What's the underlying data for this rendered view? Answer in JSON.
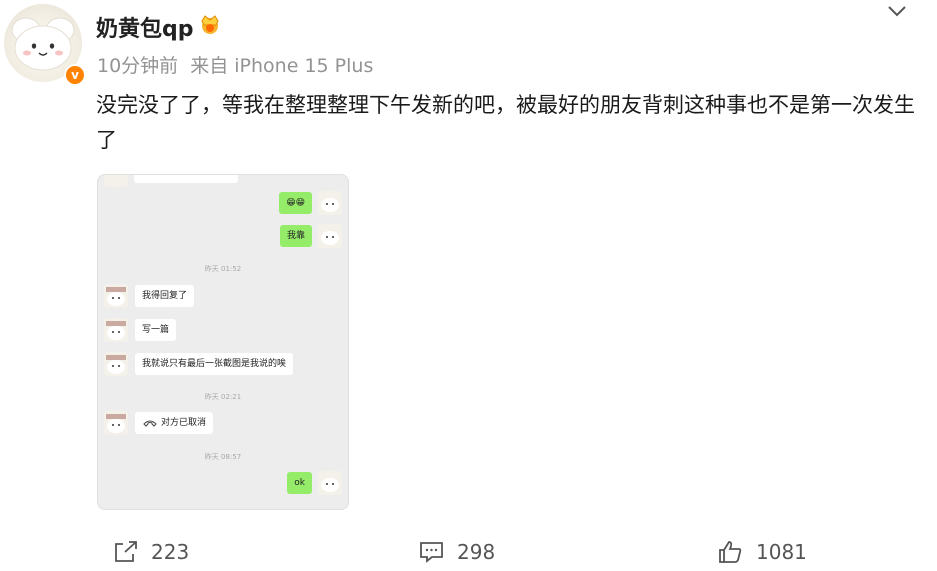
{
  "post": {
    "username": "奶黄包qp",
    "timestamp": "10分钟前",
    "source": "来自 iPhone 15 Plus",
    "text": "没完没了了，等我在整理整理下午发新的吧，被最好的朋友背刺这种事也不是第一次发生了",
    "verified_badge": "v"
  },
  "chat": {
    "messages": [
      {
        "side": "right",
        "text": "😁😁"
      },
      {
        "side": "right",
        "text": "我靠"
      },
      {
        "side": "left",
        "text": "我得回复了"
      },
      {
        "side": "left",
        "text": "写一篇"
      },
      {
        "side": "left",
        "text": "我就说只有最后一张截图是我说的唉"
      },
      {
        "side": "left",
        "text": "对方已取消",
        "icon": "phone-icon"
      },
      {
        "side": "right",
        "text": "ok"
      }
    ],
    "timestamps": [
      "昨天 01:52",
      "昨天 02:21",
      "昨天 08:57"
    ]
  },
  "actions": {
    "repost_count": "223",
    "comment_count": "298",
    "like_count": "1081"
  },
  "colors": {
    "accent_orange": "#ff8200",
    "chat_green": "#95ec69",
    "chat_bg": "#ededed"
  }
}
